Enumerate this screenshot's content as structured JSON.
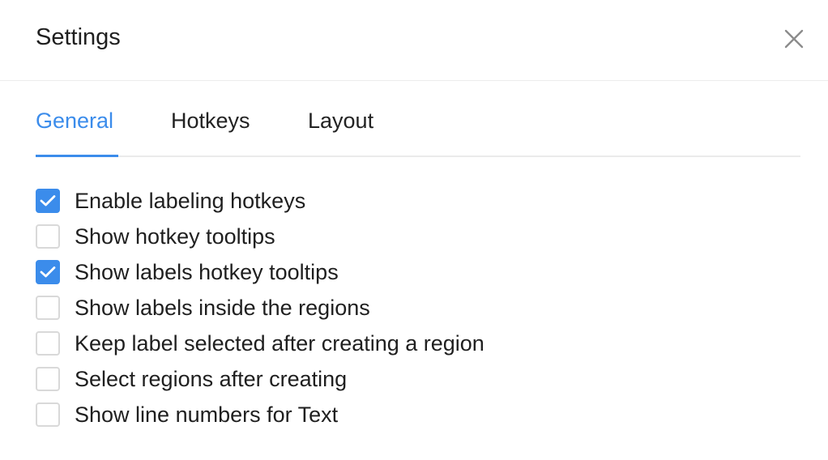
{
  "dialog": {
    "title": "Settings",
    "close_icon": "close-icon"
  },
  "tabs": [
    {
      "label": "General",
      "active": true
    },
    {
      "label": "Hotkeys",
      "active": false
    },
    {
      "label": "Layout",
      "active": false
    }
  ],
  "options": [
    {
      "label": "Enable labeling hotkeys",
      "checked": true
    },
    {
      "label": "Show hotkey tooltips",
      "checked": false
    },
    {
      "label": "Show labels hotkey tooltips",
      "checked": true
    },
    {
      "label": "Show labels inside the regions",
      "checked": false
    },
    {
      "label": "Keep label selected after creating a region",
      "checked": false
    },
    {
      "label": "Select regions after creating",
      "checked": false
    },
    {
      "label": "Show line numbers for Text",
      "checked": false
    }
  ],
  "colors": {
    "accent": "#3b8ceb",
    "text": "#1f1f1f",
    "checkbox_border": "#d9d9d9",
    "divider": "#ececec"
  }
}
